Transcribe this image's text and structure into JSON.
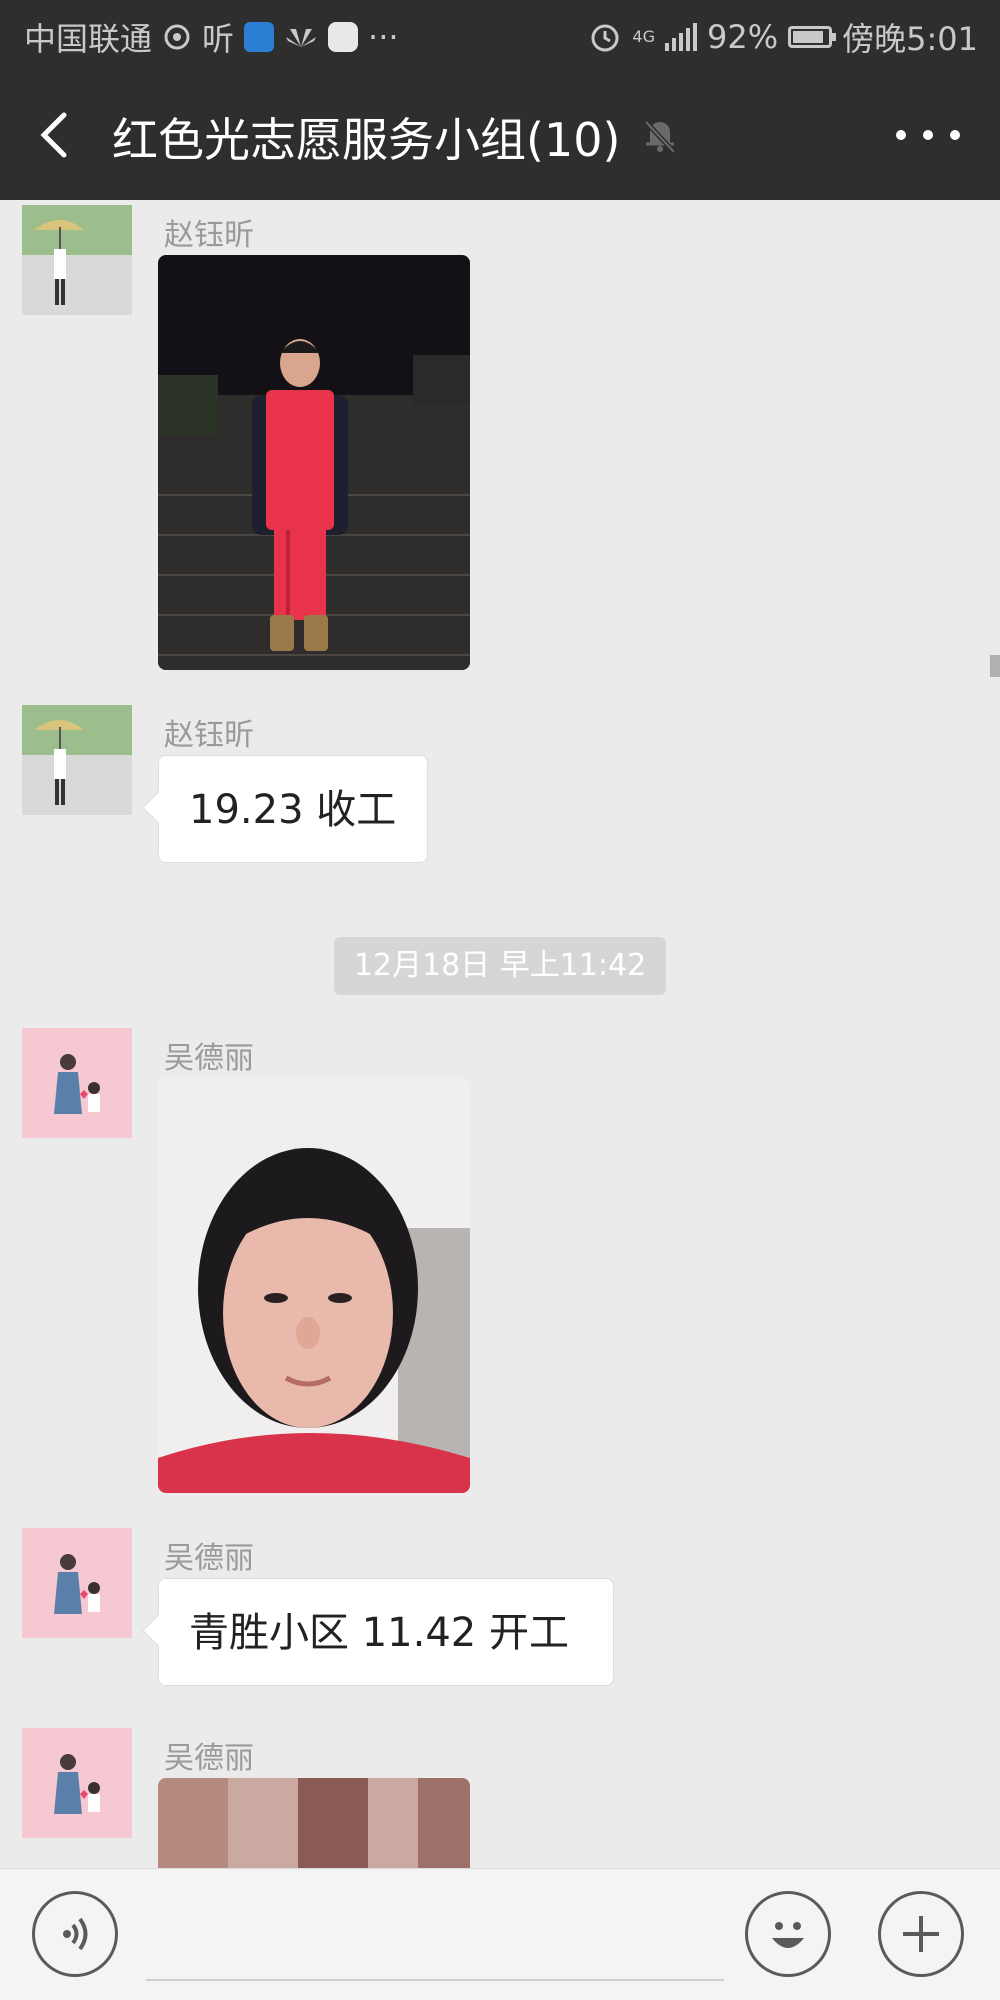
{
  "status_bar": {
    "carrier": "中国联通",
    "listen_label": "听",
    "network": "4G",
    "battery_percent": "92%",
    "time": "傍晚5:01",
    "more": "···"
  },
  "header": {
    "title": "红色光志愿服务小组(10)",
    "back_icon": "back-arrow-icon",
    "mute_icon": "bell-muted-icon",
    "more_icon": "more-dots-icon"
  },
  "messages": [
    {
      "sender": "赵钰昕",
      "type": "image",
      "image": "photo-girl-red-vest-night"
    },
    {
      "sender": "赵钰昕",
      "type": "text",
      "text": "19.23 收工"
    },
    {
      "type": "time",
      "text": "12月18日 早上11:42"
    },
    {
      "sender": "吴德丽",
      "type": "image",
      "image": "photo-girl-selfie"
    },
    {
      "sender": "吴德丽",
      "type": "text",
      "text": "青胜小区 11.42 开工"
    },
    {
      "sender": "吴德丽",
      "type": "image",
      "image": "photo-partial"
    }
  ],
  "input_bar": {
    "voice_icon": "voice-icon",
    "emoji_icon": "emoji-icon",
    "plus_icon": "plus-icon"
  },
  "colors": {
    "header_bg": "#2e2e2e",
    "chat_bg": "#ebebeb",
    "bubble_bg": "#ffffff",
    "time_label_bg": "#d6d6d6",
    "vest_red": "#e8334a"
  }
}
